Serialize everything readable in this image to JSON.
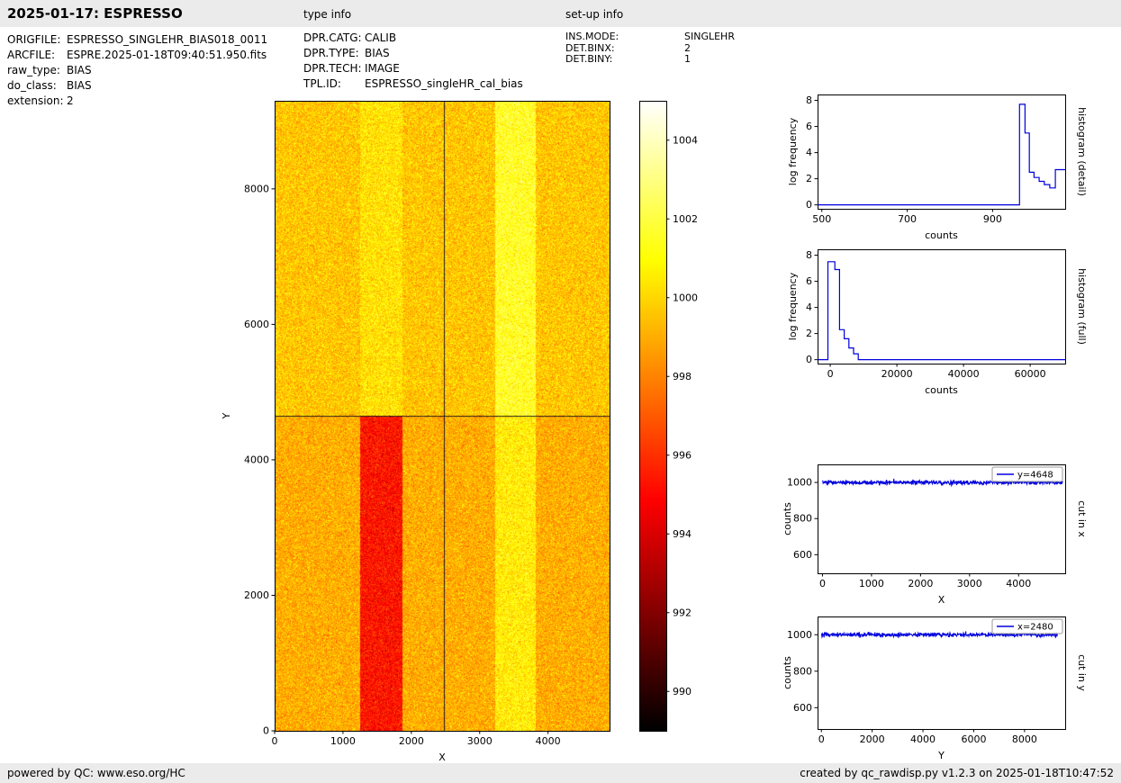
{
  "header": {
    "title": "2025-01-17: ESPRESSO",
    "type_info_label": "type info",
    "setup_info_label": "set-up info"
  },
  "file_info": {
    "rows": [
      {
        "label": "ORIGFILE:",
        "value": "ESPRESSO_SINGLEHR_BIAS018_0011"
      },
      {
        "label": "ARCFILE:",
        "value": "ESPRE.2025-01-18T09:40:51.950.fits"
      },
      {
        "label": "raw_type:",
        "value": "BIAS"
      },
      {
        "label": "do_class:",
        "value": "BIAS"
      },
      {
        "label": "extension:",
        "value": "2"
      }
    ]
  },
  "type_info": {
    "rows": [
      {
        "label": "DPR.CATG:",
        "value": "CALIB"
      },
      {
        "label": "DPR.TYPE:",
        "value": "BIAS"
      },
      {
        "label": "DPR.TECH:",
        "value": "IMAGE"
      },
      {
        "label": "TPL.ID:",
        "value": "ESPRESSO_singleHR_cal_bias"
      }
    ]
  },
  "setup_info": {
    "rows": [
      {
        "label": "INS.MODE:",
        "value": "SINGLEHR"
      },
      {
        "label": "DET.BINX:",
        "value": "2"
      },
      {
        "label": "DET.BINY:",
        "value": "1"
      }
    ]
  },
  "footer": {
    "left": "powered by QC: www.eso.org/HC",
    "right": "created by qc_rawdisp.py v1.2.3 on 2025-01-18T10:47:52"
  },
  "chart_data": [
    {
      "id": "raw_image",
      "type": "heatmap",
      "title": "",
      "xlabel": "X",
      "ylabel": "Y",
      "xlim": [
        0,
        4900
      ],
      "ylim": [
        0,
        9300
      ],
      "xticks": [
        0,
        1000,
        2000,
        3000,
        4000
      ],
      "yticks": [
        0,
        2000,
        4000,
        6000,
        8000
      ],
      "crosshair": {
        "x": 2480,
        "y": 4648
      },
      "colormap": "hot",
      "colorbar": {
        "vmin": 989,
        "vmax": 1005,
        "ticks": [
          990,
          992,
          994,
          996,
          998,
          1000,
          1002,
          1004
        ]
      },
      "noise_sigma": 0.85,
      "regions": [
        {
          "x0": 0,
          "x1": 4900,
          "y0": 0,
          "y1": 4648,
          "value": 999.0
        },
        {
          "x0": 0,
          "x1": 4900,
          "y0": 4648,
          "y1": 9300,
          "value": 999.6
        },
        {
          "x0": 1250,
          "x1": 1870,
          "y0": 4648,
          "y1": 9300,
          "value": 1000.3
        },
        {
          "x0": 1250,
          "x1": 1870,
          "y0": 0,
          "y1": 4648,
          "value": 995.3
        },
        {
          "x0": 3230,
          "x1": 3820,
          "y0": 4648,
          "y1": 9300,
          "value": 1001.5
        },
        {
          "x0": 3230,
          "x1": 3820,
          "y0": 0,
          "y1": 4648,
          "value": 1000.6
        }
      ]
    },
    {
      "id": "hist_detail",
      "type": "line",
      "title": "",
      "xlabel": "counts",
      "ylabel": "log frequency",
      "right_label": "histogram (detail)",
      "color": "#0000dd",
      "xlim": [
        490,
        1070
      ],
      "ylim": [
        -0.3,
        8.45
      ],
      "xticks": [
        500,
        700,
        900
      ],
      "yticks": [
        0,
        2,
        4,
        6,
        8
      ],
      "points": [
        [
          490,
          0
        ],
        [
          963,
          0
        ],
        [
          963,
          7.7
        ],
        [
          976,
          7.7
        ],
        [
          976,
          5.5
        ],
        [
          986,
          5.5
        ],
        [
          986,
          2.5
        ],
        [
          997,
          2.5
        ],
        [
          997,
          2.1
        ],
        [
          1009,
          2.1
        ],
        [
          1009,
          1.8
        ],
        [
          1021,
          1.8
        ],
        [
          1021,
          1.55
        ],
        [
          1034,
          1.55
        ],
        [
          1034,
          1.3
        ],
        [
          1047,
          1.3
        ],
        [
          1047,
          2.7
        ],
        [
          1070,
          2.7
        ]
      ]
    },
    {
      "id": "hist_full",
      "type": "line",
      "title": "",
      "xlabel": "counts",
      "ylabel": "log frequency",
      "right_label": "histogram (full)",
      "color": "#0000dd",
      "xlim": [
        -3800,
        70500
      ],
      "ylim": [
        -0.3,
        8.45
      ],
      "xticks": [
        0,
        20000,
        40000,
        60000
      ],
      "yticks": [
        0,
        2,
        4,
        6,
        8
      ],
      "points": [
        [
          -3800,
          0
        ],
        [
          -700,
          0
        ],
        [
          -700,
          7.5
        ],
        [
          1400,
          7.5
        ],
        [
          1400,
          6.9
        ],
        [
          2800,
          6.9
        ],
        [
          2800,
          2.3
        ],
        [
          4200,
          2.3
        ],
        [
          4200,
          1.6
        ],
        [
          5600,
          1.6
        ],
        [
          5600,
          0.9
        ],
        [
          7000,
          0.9
        ],
        [
          7000,
          0.45
        ],
        [
          8400,
          0.45
        ],
        [
          8400,
          0
        ],
        [
          70500,
          0
        ]
      ]
    },
    {
      "id": "cut_x",
      "type": "line",
      "title": "",
      "xlabel": "X",
      "ylabel": "counts",
      "right_label": "cut in x",
      "legend": "y=4648",
      "color": "#0000dd",
      "xlim": [
        -100,
        4950
      ],
      "ylim": [
        497,
        1100
      ],
      "xticks": [
        0,
        1000,
        2000,
        3000,
        4000
      ],
      "yticks": [
        600,
        800,
        1000
      ],
      "series": {
        "x_range": [
          0,
          4900
        ],
        "mean": 1000,
        "sigma": 6,
        "n_points": 700
      }
    },
    {
      "id": "cut_y",
      "type": "line",
      "title": "",
      "xlabel": "Y",
      "ylabel": "counts",
      "right_label": "cut in y",
      "legend": "x=2480",
      "color": "#0000dd",
      "xlim": [
        -150,
        9600
      ],
      "ylim": [
        483,
        1100
      ],
      "xticks": [
        0,
        2000,
        4000,
        6000,
        8000
      ],
      "yticks": [
        600,
        800,
        1000
      ],
      "series": {
        "x_range": [
          0,
          9300
        ],
        "mean": 1000,
        "sigma": 6,
        "n_points": 700
      }
    }
  ]
}
